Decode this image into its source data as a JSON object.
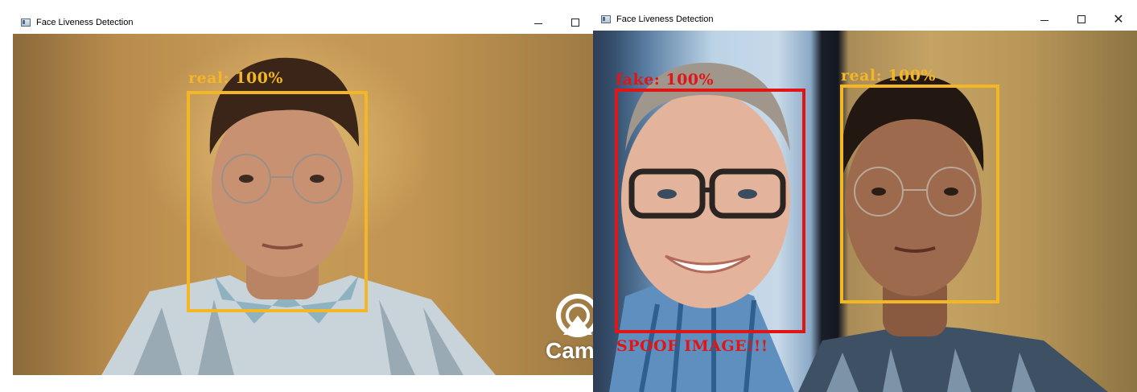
{
  "left_window": {
    "title": "Face Liveness Detection",
    "controls": {
      "minimize": "–",
      "maximize": "☐"
    },
    "detections": [
      {
        "label": "real: 100%",
        "color": "#f3b625"
      }
    ],
    "watermark": "Cam"
  },
  "right_window": {
    "title": "Face Liveness Detection",
    "controls": {
      "minimize": "–",
      "maximize": "☐",
      "close": "✕"
    },
    "detections": [
      {
        "label": "fake: 100%",
        "color": "#e01616",
        "warning": "SPOOF IMAGE!!!"
      },
      {
        "label": "real: 100%",
        "color": "#f3b625"
      }
    ]
  }
}
